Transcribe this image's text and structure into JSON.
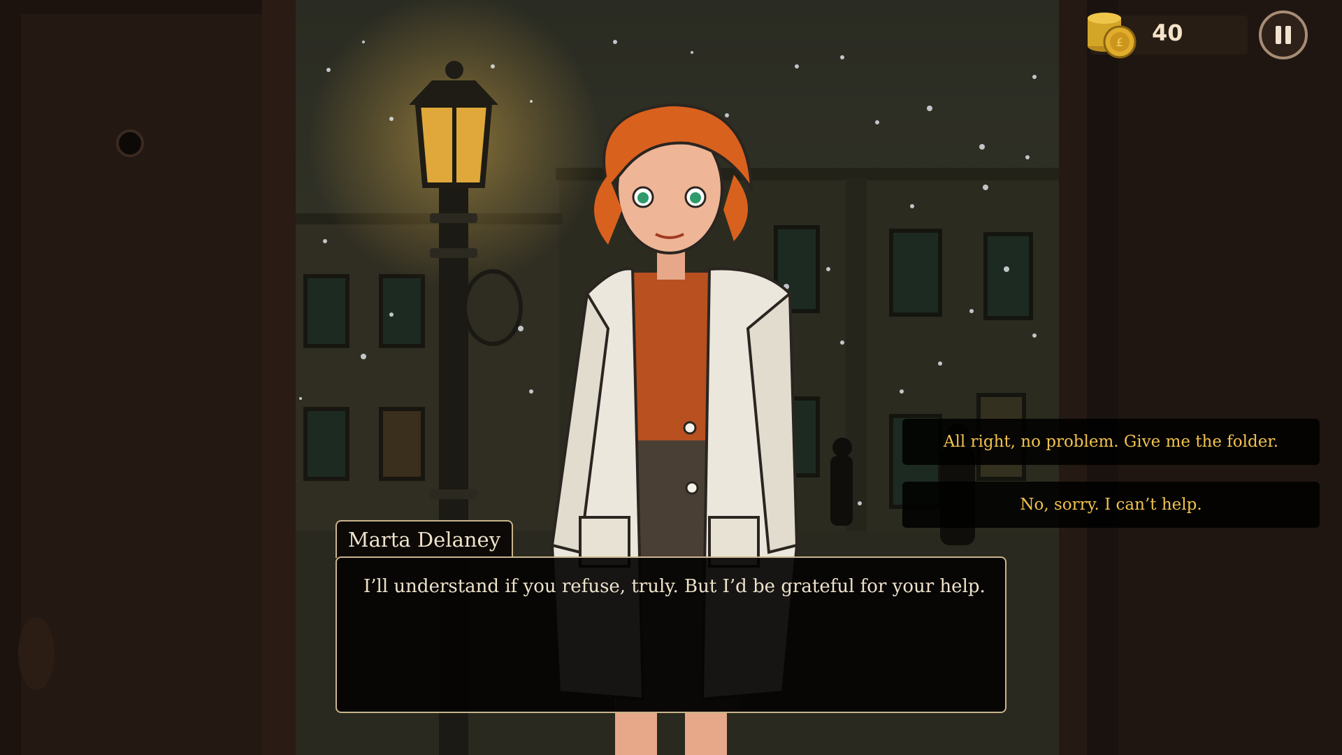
{
  "hud": {
    "coins": "40",
    "coin_icon": "coin-stack-icon",
    "pause_icon": "pause-icon"
  },
  "choices": [
    {
      "label": "All right, no problem. Give me the folder."
    },
    {
      "label": "No, sorry. I can’t help."
    }
  ],
  "dialog": {
    "speaker": "Marta Delaney",
    "text": "I’ll understand if you refuse, truly. But I’d be grateful for your help."
  },
  "colors": {
    "choice_text": "#f2c24e",
    "dialog_border": "#c9b48c",
    "hair": "#d9611e",
    "coat": "#ece7dc"
  }
}
